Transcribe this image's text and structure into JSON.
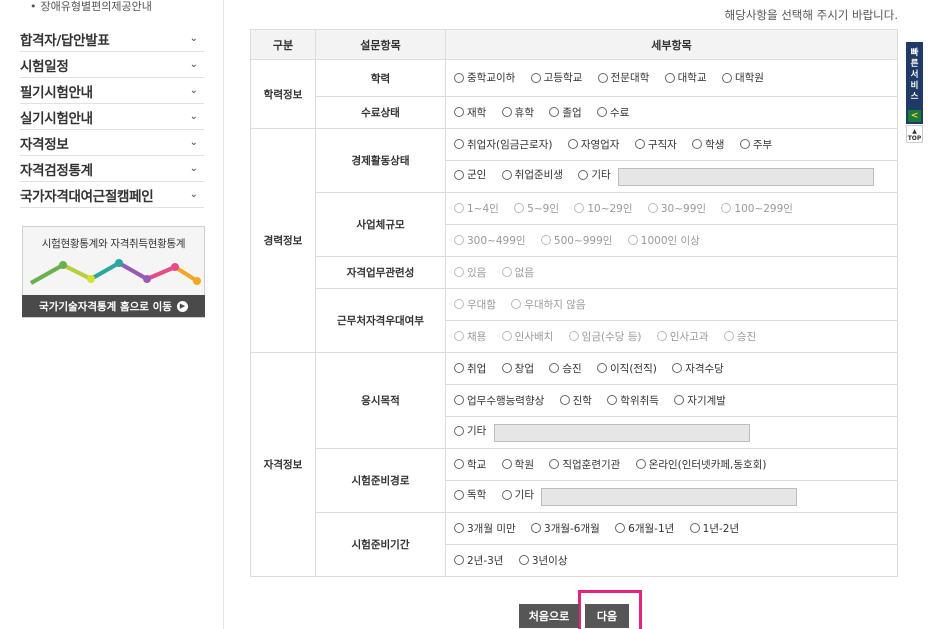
{
  "sidebar": {
    "sub_item": "장애유형별편의제공안내",
    "menu": [
      {
        "label": "합격자/답안발표"
      },
      {
        "label": "시험일정"
      },
      {
        "label": "필기시험안내"
      },
      {
        "label": "실기시험안내"
      },
      {
        "label": "자격정보"
      },
      {
        "label": "자격검정통계"
      },
      {
        "label": "국가자격대여근절캠페인"
      }
    ],
    "stats_banner": {
      "title": "시험현황통계와 자격취득현황통계",
      "link_label": "국가기술자격통계 홈으로 이동"
    }
  },
  "main": {
    "notice": "해당사항을 선택해 주시기 바랍니다.",
    "table": {
      "headers": [
        "구분",
        "설문항목",
        "세부항목"
      ],
      "categories": {
        "education": "학력정보",
        "career": "경력정보",
        "qualification": "자격정보"
      },
      "items": {
        "education_level": {
          "label": "학력",
          "options": [
            "중학교이하",
            "고등학교",
            "전문대학",
            "대학교",
            "대학원"
          ]
        },
        "completion": {
          "label": "수료상태",
          "options": [
            "재학",
            "휴학",
            "졸업",
            "수료"
          ]
        },
        "economic": {
          "label": "경제활동상태",
          "options_row1": [
            "취업자(임금근로자)",
            "자영업자",
            "구직자",
            "학생",
            "주부"
          ],
          "options_row2": [
            "군인",
            "취업준비생",
            "기타"
          ]
        },
        "company_size": {
          "label": "사업체규모",
          "options_row1": [
            "1~4인",
            "5~9인",
            "10~29인",
            "30~99인",
            "100~299인"
          ],
          "options_row2": [
            "300~499인",
            "500~999인",
            "1000인 이상"
          ]
        },
        "relevance": {
          "label": "자격업무관련성",
          "options": [
            "있음",
            "없음"
          ]
        },
        "preference": {
          "label": "근무처자격우대여부",
          "options_row1": [
            "우대함",
            "우대하지 않음"
          ],
          "options_row2": [
            "채용",
            "인사배치",
            "임금(수당 등)",
            "인사고과",
            "승진"
          ]
        },
        "purpose": {
          "label": "응시목적",
          "options_row1": [
            "취업",
            "창업",
            "승진",
            "이직(전직)",
            "자격수당"
          ],
          "options_row2": [
            "업무수행능력향상",
            "진학",
            "학위취득",
            "자기계발"
          ],
          "options_row3": [
            "기타"
          ]
        },
        "prep_route": {
          "label": "시험준비경로",
          "options_row1": [
            "학교",
            "학원",
            "직업훈련기관",
            "온라인(인터넷카페,동호회)"
          ],
          "options_row2": [
            "독학",
            "기타"
          ]
        },
        "prep_period": {
          "label": "시험준비기간",
          "options_row1": [
            "3개월 미만",
            "3개월-6개월",
            "6개월-1년",
            "1년-2년"
          ],
          "options_row2": [
            "2년-3년",
            "3년이상"
          ]
        }
      }
    },
    "buttons": {
      "reset": "처음으로",
      "next": "다음"
    }
  },
  "quick_bar": {
    "label": "빠른서비스",
    "arrow": "<",
    "top": "TOP"
  },
  "colors": {
    "highlight": "#e8237e",
    "quick_bar": "#1f3a66",
    "button": "#565656"
  }
}
